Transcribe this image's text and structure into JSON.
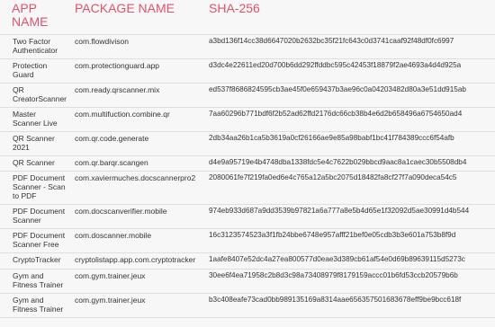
{
  "headers": {
    "app": "APP NAME",
    "package": "PACKAGE NAME",
    "sha": "SHA-256"
  },
  "rows": [
    {
      "app": "Two Factor Authenticator",
      "package": "com.flowdivison",
      "sha": "a3bd136f14cc38d6647020b2632bc35f21fc643c0d3741caaf92f48df0fc6997"
    },
    {
      "app": "Protection Guard",
      "package": "com.protectionguard.app",
      "sha": "d3dc4e22611ed20d700b6dd292ffddbc595c42453f18879f2ae4693a4d4d925a"
    },
    {
      "app": "QR CreatorScanner",
      "package": "com.ready.qrscanner.mix",
      "sha": "ed537f8686824595cb3ae45f0e659437b3ae96c0a04203482d80a3e51dd915ab"
    },
    {
      "app": "Master Scanner Live",
      "package": "com.multifuction.combine.qr",
      "sha": "7aa60296b771bdf6f2b52ad62ffd2176dc66cb38b4e6d2b658496a6754650ad4"
    },
    {
      "app": "QR Scanner 2021",
      "package": "com.qr.code.generate",
      "sha": "2db34aa26b1ca5b3619a0cf26166ae9e85a98babf1bc41f784389ccc6f54afb"
    },
    {
      "app": "QR Scanner",
      "package": "com.qr.barqr.scangen",
      "sha": "d4e9a95719e4b4748dba1338fdc5e4c7622b029bbcd9aac8a1caec30b5508db4"
    },
    {
      "app": "PDF Document Scanner - Scan to PDF",
      "package": "com.xaviermuches.docscannerpro2",
      "sha": "2080061fe7f219fa0ed6e4c765a12a5bc2075d18482fa8cf27f7a090deca54c5"
    },
    {
      "app": "PDF Document Scanner",
      "package": "com.docscanverifier.mobile",
      "sha": "974eb933d687a9dd3539b97821a6a777a8e5b4d65e1f32092d5ae30991d4b544"
    },
    {
      "app": "PDF Document Scanner Free",
      "package": "com.doscanner.mobile",
      "sha": "16c3123574523a3f1fb24bbe6748e957afff21bef0e05cdb3b3e601a753b8f9d"
    },
    {
      "app": "CryptoTracker",
      "package": "cryptolistapp.app.com.cryptotracker",
      "sha": "1aafe8407e52dc4a27ea800577d0eae3d389cb61af54e0d69b89639115d5273c"
    },
    {
      "app": "Gym and Fitness Trainer",
      "package": "com.gym.trainer.jeux",
      "sha": "30ee6f4ea71958c2b8d3c98a73408979f8179159accc01b6fd53ccb20579b6b"
    },
    {
      "app": "Gym and Fitness Trainer",
      "package": "com.gym.trainer.jeux",
      "sha": "b3c408eafe73cad0bb989135169a8314aae656357501683678eff9be9bcc618f"
    }
  ]
}
